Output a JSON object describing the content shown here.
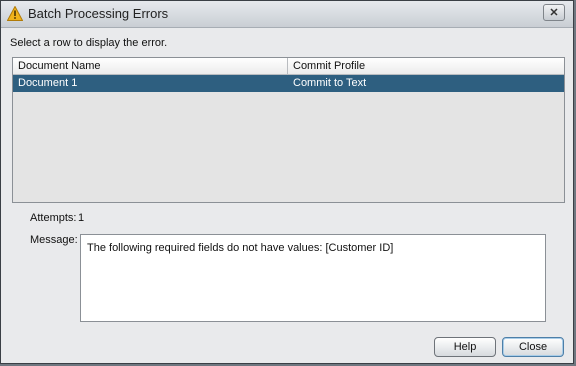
{
  "window": {
    "title": "Batch Processing Errors",
    "close_glyph": "✕",
    "icon": "warning-icon"
  },
  "instruction": "Select a row to display the error.",
  "table": {
    "columns": [
      "Document Name",
      "Commit Profile"
    ],
    "rows": [
      {
        "document_name": "Document 1",
        "commit_profile": "Commit to Text",
        "selected": true
      }
    ]
  },
  "attempts": {
    "label": "Attempts:",
    "value": "1"
  },
  "message": {
    "label": "Message:",
    "text": "The following required fields do not have values: [Customer ID]"
  },
  "buttons": {
    "help": "Help",
    "close": "Close"
  },
  "colors": {
    "selection": "#2e5f80",
    "warning": "#f0b21a"
  }
}
